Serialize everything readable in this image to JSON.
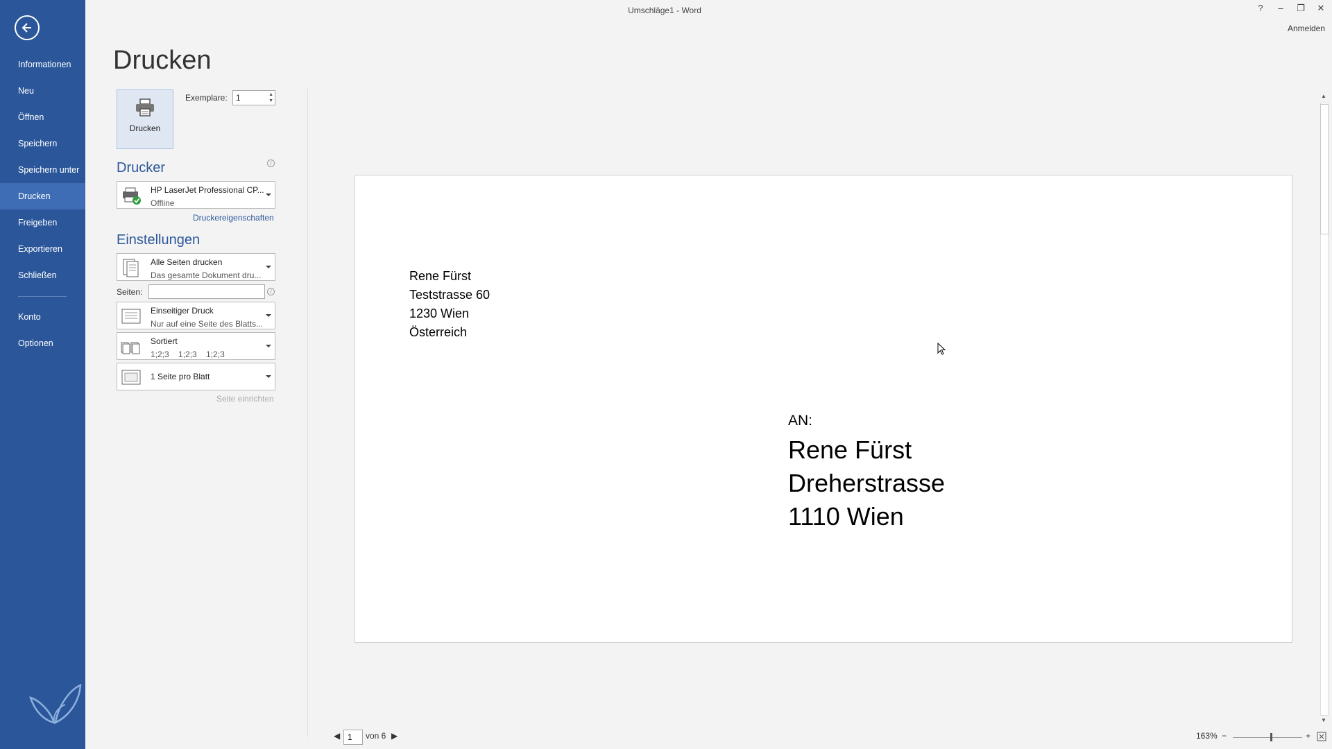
{
  "window": {
    "title": "Umschläge1 - Word",
    "help": "?",
    "minimize": "–",
    "restore": "❐",
    "close": "✕",
    "signin": "Anmelden"
  },
  "sidebar": {
    "items": [
      {
        "label": "Informationen"
      },
      {
        "label": "Neu"
      },
      {
        "label": "Öffnen"
      },
      {
        "label": "Speichern"
      },
      {
        "label": "Speichern unter"
      },
      {
        "label": "Drucken"
      },
      {
        "label": "Freigeben"
      },
      {
        "label": "Exportieren"
      },
      {
        "label": "Schließen"
      },
      {
        "label": "Konto"
      },
      {
        "label": "Optionen"
      }
    ],
    "active": "Drucken"
  },
  "print": {
    "title": "Drucken",
    "button_label": "Drucken",
    "copies_label": "Exemplare:",
    "copies_value": "1"
  },
  "printer": {
    "heading": "Drucker",
    "name": "HP LaserJet Professional CP...",
    "status": "Offline",
    "properties_link": "Druckereigenschaften"
  },
  "settings": {
    "heading": "Einstellungen",
    "range": {
      "line1": "Alle Seiten drucken",
      "line2": "Das gesamte Dokument dru..."
    },
    "pages_label": "Seiten:",
    "pages_value": "",
    "sides": {
      "line1": "Einseitiger Druck",
      "line2": "Nur auf eine Seite des Blatts..."
    },
    "collate": {
      "line1": "Sortiert",
      "line2": "1;2;3    1;2;3    1;2;3"
    },
    "per_sheet": {
      "line1": "1 Seite pro Blatt"
    },
    "page_setup_link": "Seite einrichten"
  },
  "preview": {
    "sender": [
      "Rene Fürst",
      "Teststrasse 60",
      "1230 Wien",
      "Österreich"
    ],
    "recipient_label": "AN:",
    "recipient": [
      "Rene Fürst",
      "Dreherstrasse",
      "1110 Wien"
    ]
  },
  "footer": {
    "page_value": "1",
    "page_of": "von 6",
    "zoom": "163%",
    "zoom_level": 0.55
  }
}
